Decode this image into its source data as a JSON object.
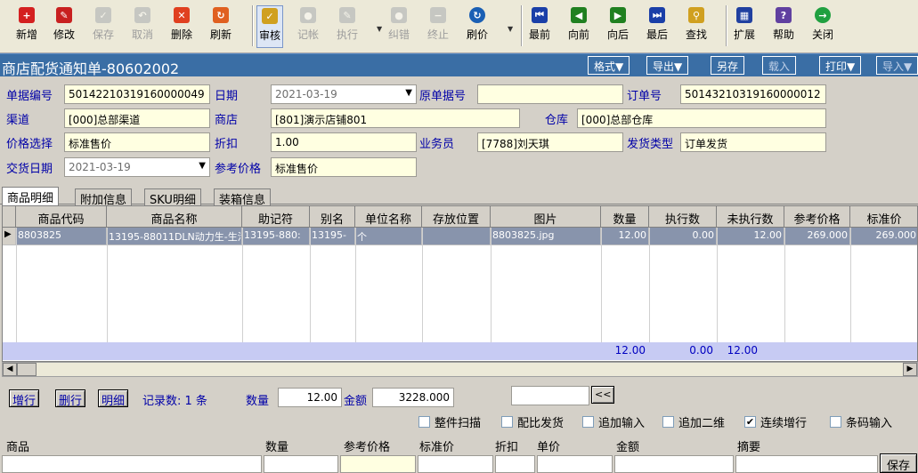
{
  "toolbar": {
    "buttons": [
      {
        "label": "新增",
        "icon": "new-icon",
        "color": "#d42020",
        "glyph": "+"
      },
      {
        "label": "修改",
        "icon": "edit-icon",
        "color": "#c82020",
        "glyph": "✎"
      },
      {
        "label": "保存",
        "icon": "save-icon",
        "color": "#9aa0a8",
        "glyph": "✓"
      },
      {
        "label": "取消",
        "icon": "cancel-icon",
        "color": "#9aa0a8",
        "glyph": "↶"
      },
      {
        "label": "删除",
        "icon": "delete-icon",
        "color": "#e04020",
        "glyph": "✕"
      },
      {
        "label": "刷新",
        "icon": "refresh-icon",
        "color": "#e06020",
        "glyph": "↻"
      },
      {
        "label": "审核",
        "icon": "audit-icon",
        "color": "#d0a020",
        "glyph": "✓"
      },
      {
        "label": "记帐",
        "icon": "post-icon",
        "color": "#9aa0a8",
        "glyph": "●"
      },
      {
        "label": "执行",
        "icon": "execute-icon",
        "color": "#9aa0a8",
        "glyph": "✎"
      },
      {
        "label": "纠错",
        "icon": "correct-icon",
        "color": "#9aa0a8",
        "glyph": "●"
      },
      {
        "label": "终止",
        "icon": "stop-icon",
        "color": "#9aa0a8",
        "glyph": "−"
      },
      {
        "label": "刷价",
        "icon": "reprice-icon",
        "color": "#1a5fb4",
        "glyph": "↻"
      },
      {
        "label": "最前",
        "icon": "first-icon",
        "color": "#1a3fa8",
        "glyph": "⏮"
      },
      {
        "label": "向前",
        "icon": "prev-icon",
        "color": "#208020",
        "glyph": "◀"
      },
      {
        "label": "向后",
        "icon": "next-icon",
        "color": "#208020",
        "glyph": "▶"
      },
      {
        "label": "最后",
        "icon": "last-icon",
        "color": "#1a3fa8",
        "glyph": "⏭"
      },
      {
        "label": "查找",
        "icon": "find-icon",
        "color": "#d0a020",
        "glyph": "⚲"
      },
      {
        "label": "扩展",
        "icon": "extend-icon",
        "color": "#2040a0",
        "glyph": "▦"
      },
      {
        "label": "帮助",
        "icon": "help-icon",
        "color": "#6040a0",
        "glyph": "?"
      },
      {
        "label": "关闭",
        "icon": "close-icon",
        "color": "#20a040",
        "glyph": "→"
      }
    ]
  },
  "titlebar": {
    "title": "商店配货通知单-80602002",
    "buttons": [
      "格式▼",
      "导出▼",
      "另存",
      "载入",
      "打印▼",
      "导入▼"
    ]
  },
  "form": {
    "bill_no_label": "单据编号",
    "bill_no": "50142210319160000049",
    "date_label": "日期",
    "date": "2021-03-19",
    "orig_no_label": "原单据号",
    "orig_no": "",
    "order_no_label": "订单号",
    "order_no": "50143210319160000012",
    "channel_label": "渠道",
    "channel": "[000]总部渠道",
    "shop_label": "商店",
    "shop": "[801]演示店铺801",
    "warehouse_label": "仓库",
    "warehouse": "[000]总部仓库",
    "price_sel_label": "价格选择",
    "price_sel": "标准售价",
    "discount_label": "折扣",
    "discount": "1.00",
    "salesman_label": "业务员",
    "salesman": "[7788]刘天琪",
    "ship_type_label": "发货类型",
    "ship_type": "订单发货",
    "delivery_label": "交货日期",
    "delivery": "2021-03-19",
    "ref_price_label": "参考价格",
    "ref_price": "标准售价"
  },
  "tabs": [
    "商品明细",
    "附加信息",
    "SKU明细",
    "装箱信息"
  ],
  "grid": {
    "columns": [
      "商品代码",
      "商品名称",
      "助记符",
      "别名",
      "单位名称",
      "存放位置",
      "图片",
      "数量",
      "执行数",
      "未执行数",
      "参考价格",
      "标准价"
    ],
    "rows": [
      [
        "8803825",
        "13195-88011DLN动力生-生活鞋",
        "13195-880:",
        "13195-",
        "个",
        "",
        "8803825.jpg",
        "12.00",
        "0.00",
        "12.00",
        "269.000",
        "269.000"
      ]
    ],
    "totals": {
      "qty": "12.00",
      "exec": "0.00",
      "unexec": "12.00"
    }
  },
  "actions": {
    "add_row": "增行",
    "del_row": "删行",
    "detail": "明细",
    "record_count_label": "记录数: 1 条",
    "qty_label": "数量",
    "qty": "12.00",
    "amount_label": "金额",
    "amount": "3228.000",
    "collapse": "<<"
  },
  "options": [
    {
      "label": "整件扫描",
      "checked": false
    },
    {
      "label": "配比发货",
      "checked": false
    },
    {
      "label": "追加输入",
      "checked": false
    },
    {
      "label": "追加二维",
      "checked": false
    },
    {
      "label": "连续增行",
      "checked": true
    },
    {
      "label": "条码输入",
      "checked": false
    }
  ],
  "entry": {
    "headers": [
      "商品",
      "数量",
      "参考价格",
      "标准价",
      "折扣",
      "单价",
      "金额",
      "摘要"
    ],
    "save": "保存"
  }
}
